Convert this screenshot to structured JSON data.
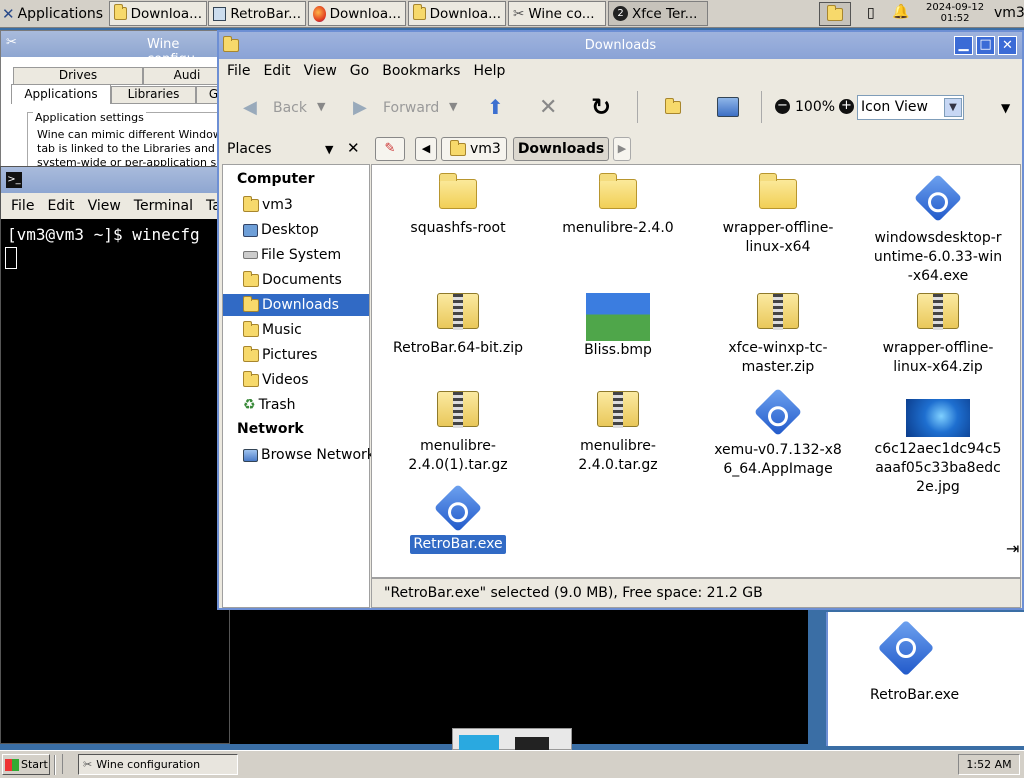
{
  "top_panel": {
    "applications": "Applications",
    "tasks": [
      "Downloa...",
      "RetroBar...",
      "Downloa...",
      "Downloa...",
      "Wine co...",
      "Xfce Ter..."
    ],
    "terminal_badge": "2",
    "date": "2024-09-12",
    "time": "01:52",
    "user": "vm3"
  },
  "wine": {
    "title": "Wine configu",
    "tabs_row1": [
      "Drives",
      "Audi"
    ],
    "tabs_row2": [
      "Applications",
      "Libraries",
      "G"
    ],
    "group_label": "Application settings",
    "desc": [
      "Wine can mimic different Windows ver",
      "tab is linked to the Libraries and Graph",
      "system-wide or per-application setting"
    ]
  },
  "terminal": {
    "menu": [
      "File",
      "Edit",
      "View",
      "Terminal",
      "Tabs"
    ],
    "prompt": "[vm3@vm3 ~]$ winecfg"
  },
  "fm": {
    "title": "Downloads",
    "menu": [
      "File",
      "Edit",
      "View",
      "Go",
      "Bookmarks",
      "Help"
    ],
    "toolbar": {
      "back": "Back",
      "forward": "Forward",
      "zoom": "100%",
      "view": "Icon View"
    },
    "places_label": "Places",
    "path": [
      "vm3",
      "Downloads"
    ],
    "sidebar": {
      "computer_header": "Computer",
      "computer": [
        "vm3",
        "Desktop",
        "File System",
        "Documents",
        "Downloads",
        "Music",
        "Pictures",
        "Videos",
        "Trash"
      ],
      "network_header": "Network",
      "network": [
        "Browse Network"
      ]
    },
    "files": [
      {
        "name": "squashfs-root",
        "icon": "folder-icon"
      },
      {
        "name": "menulibre-2.4.0",
        "icon": "folder-icon"
      },
      {
        "name": "wrapper-offline-linux-x64",
        "icon": "folder-icon"
      },
      {
        "name": "windowsdesktop-runtime-6.0.33-win-x64.exe",
        "icon": "executable-icon"
      },
      {
        "name": "RetroBar.64-bit.zip",
        "icon": "archive-icon"
      },
      {
        "name": "Bliss.bmp",
        "icon": "image-icon"
      },
      {
        "name": "xfce-winxp-tc-master.zip",
        "icon": "archive-icon"
      },
      {
        "name": "wrapper-offline-linux-x64.zip",
        "icon": "archive-icon"
      },
      {
        "name": "menulibre-2.4.0(1).tar.gz",
        "icon": "archive-icon"
      },
      {
        "name": "menulibre-2.4.0.tar.gz",
        "icon": "archive-icon"
      },
      {
        "name": "xemu-v0.7.132-x86_64.AppImage",
        "icon": "executable-icon"
      },
      {
        "name": "c6c12aec1dc94c5aaaf05c33ba8edc2e.jpg",
        "icon": "image-icon"
      },
      {
        "name": "RetroBar.exe",
        "icon": "executable-icon",
        "selected": true
      }
    ],
    "status": "\"RetroBar.exe\" selected (9.0 MB), Free space: 21.2 GB"
  },
  "desktop": {
    "icon_label": "RetroBar.exe"
  },
  "taskbar": {
    "start": "Start",
    "task": "Wine configuration",
    "clock": "1:52 AM"
  }
}
